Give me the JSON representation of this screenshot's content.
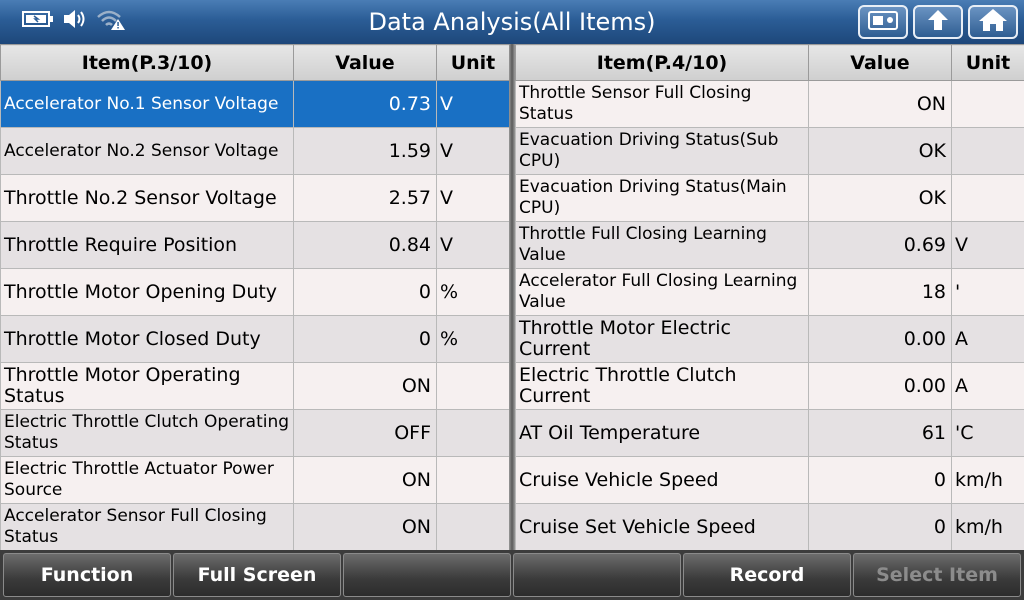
{
  "header": {
    "title": "Data Analysis(All Items)",
    "icons": [
      "battery-icon",
      "speaker-icon",
      "wifi-warning-icon"
    ],
    "buttons": [
      "record-screen-icon",
      "back-arrow-icon",
      "home-icon"
    ]
  },
  "left_table": {
    "headers": {
      "item": "Item(P.3/10)",
      "value": "Value",
      "unit": "Unit"
    },
    "rows": [
      {
        "item": "Accelerator No.1 Sensor Voltage",
        "value": "0.73",
        "unit": "V"
      },
      {
        "item": "Accelerator No.2 Sensor Voltage",
        "value": "1.59",
        "unit": "V"
      },
      {
        "item": "Throttle No.2 Sensor Voltage",
        "value": "2.57",
        "unit": "V"
      },
      {
        "item": "Throttle Require Position",
        "value": "0.84",
        "unit": "V"
      },
      {
        "item": "Throttle Motor Opening Duty",
        "value": "0",
        "unit": "%"
      },
      {
        "item": "Throttle Motor Closed Duty",
        "value": "0",
        "unit": "%"
      },
      {
        "item": "Throttle Motor Operating Status",
        "value": "ON",
        "unit": ""
      },
      {
        "item": "Electric Throttle Clutch Operating Status",
        "value": "OFF",
        "unit": ""
      },
      {
        "item": "Electric Throttle Actuator Power Source",
        "value": "ON",
        "unit": ""
      },
      {
        "item": "Accelerator Sensor Full Closing Status",
        "value": "ON",
        "unit": ""
      }
    ]
  },
  "right_table": {
    "headers": {
      "item": "Item(P.4/10)",
      "value": "Value",
      "unit": "Unit"
    },
    "rows": [
      {
        "item": "Throttle Sensor Full Closing Status",
        "value": "ON",
        "unit": ""
      },
      {
        "item": "Evacuation Driving Status(Sub CPU)",
        "value": "OK",
        "unit": ""
      },
      {
        "item": "Evacuation Driving Status(Main CPU)",
        "value": "OK",
        "unit": ""
      },
      {
        "item": "Throttle Full Closing Learning Value",
        "value": "0.69",
        "unit": "V"
      },
      {
        "item": "Accelerator Full Closing Learning Value",
        "value": "18",
        "unit": "'"
      },
      {
        "item": "Throttle Motor Electric Current",
        "value": "0.00",
        "unit": "A"
      },
      {
        "item": "Electric Throttle Clutch Current",
        "value": "0.00",
        "unit": "A"
      },
      {
        "item": "AT Oil Temperature",
        "value": "61",
        "unit": "'C"
      },
      {
        "item": "Cruise Vehicle Speed",
        "value": "0",
        "unit": "km/h"
      },
      {
        "item": "Cruise Set Vehicle Speed",
        "value": "0",
        "unit": "km/h"
      }
    ]
  },
  "footer": {
    "buttons": [
      {
        "label": "Function",
        "enabled": true
      },
      {
        "label": "Full Screen",
        "enabled": true
      },
      {
        "label": "",
        "enabled": true
      },
      {
        "label": "",
        "enabled": true
      },
      {
        "label": "Record",
        "enabled": true
      },
      {
        "label": "Select Item",
        "enabled": false
      }
    ]
  },
  "colors": {
    "selected_row": "#1970c4",
    "title_bar": "#2b5d96"
  }
}
